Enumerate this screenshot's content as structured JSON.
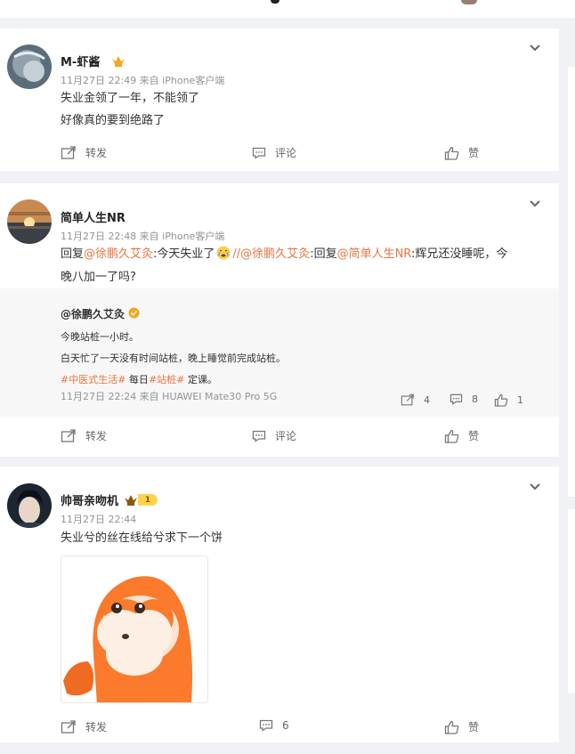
{
  "posts": [
    {
      "username": "M-虾酱",
      "meta": "11月27日 22:49  来自 iPhone客户端",
      "lines": [
        "失业金领了一年，不能领了",
        "好像真的要到绝路了"
      ],
      "actions": {
        "repost": "转发",
        "comment": "评论",
        "like": "赞"
      }
    },
    {
      "username": "简单人生NR",
      "meta": "11月27日 22:48  来自 iPhone客户端",
      "reply": {
        "p1": "回复",
        "m1": "@徐鹏久艾灸",
        "p2": ":今天失业了",
        "m2": "//@徐鹏久艾灸",
        "p3": ":回复",
        "m3": "@简单人生NR",
        "p4": ":辉兄还没睡呢，今",
        "line2": "晚八加一了吗?"
      },
      "quote": {
        "username": "@徐鹏久艾灸",
        "line1": "今晚站桩一小时。",
        "line2": "白天忙了一天没有时间站桩，晚上睡觉前完成站桩。",
        "tag1": "#中医式生活#",
        "mid": " 每日",
        "tag2": "#站桩#",
        "end": " 定课。",
        "meta": "11月27日 22:24 来自 HUAWEI Mate30 Pro 5G",
        "reposts": "4",
        "comments": "8",
        "likes": "1"
      },
      "actions": {
        "repost": "转发",
        "comment": "评论",
        "like": "赞"
      }
    },
    {
      "username": "帅哥亲吻机",
      "level": "1",
      "meta": "11月27日 22:44",
      "lines": [
        "失业兮的丝在线给兮求下一个饼"
      ],
      "actions": {
        "repost": "转发",
        "comment": "6",
        "like": "赞"
      }
    }
  ],
  "colors": {
    "link": "#eb7340",
    "meta": "#939393",
    "page_bg": "#f1f2f5"
  }
}
